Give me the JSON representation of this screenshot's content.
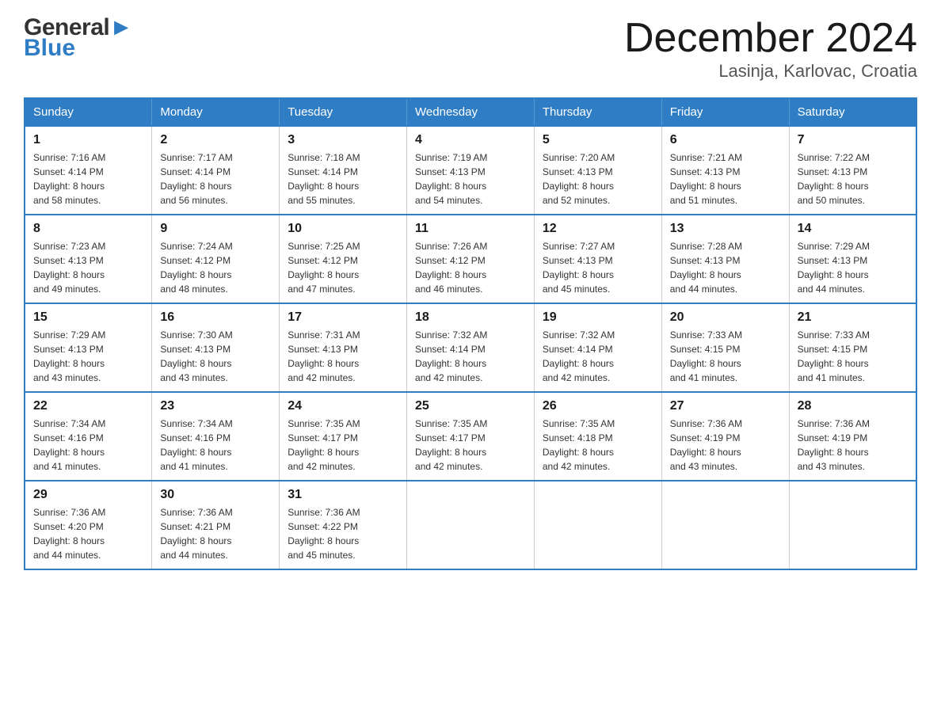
{
  "header": {
    "logo_line1": "General",
    "logo_line2": "Blue",
    "month_title": "December 2024",
    "location": "Lasinja, Karlovac, Croatia"
  },
  "columns": [
    "Sunday",
    "Monday",
    "Tuesday",
    "Wednesday",
    "Thursday",
    "Friday",
    "Saturday"
  ],
  "weeks": [
    [
      {
        "day": "1",
        "sunrise": "7:16 AM",
        "sunset": "4:14 PM",
        "daylight": "8 hours and 58 minutes."
      },
      {
        "day": "2",
        "sunrise": "7:17 AM",
        "sunset": "4:14 PM",
        "daylight": "8 hours and 56 minutes."
      },
      {
        "day": "3",
        "sunrise": "7:18 AM",
        "sunset": "4:14 PM",
        "daylight": "8 hours and 55 minutes."
      },
      {
        "day": "4",
        "sunrise": "7:19 AM",
        "sunset": "4:13 PM",
        "daylight": "8 hours and 54 minutes."
      },
      {
        "day": "5",
        "sunrise": "7:20 AM",
        "sunset": "4:13 PM",
        "daylight": "8 hours and 52 minutes."
      },
      {
        "day": "6",
        "sunrise": "7:21 AM",
        "sunset": "4:13 PM",
        "daylight": "8 hours and 51 minutes."
      },
      {
        "day": "7",
        "sunrise": "7:22 AM",
        "sunset": "4:13 PM",
        "daylight": "8 hours and 50 minutes."
      }
    ],
    [
      {
        "day": "8",
        "sunrise": "7:23 AM",
        "sunset": "4:13 PM",
        "daylight": "8 hours and 49 minutes."
      },
      {
        "day": "9",
        "sunrise": "7:24 AM",
        "sunset": "4:12 PM",
        "daylight": "8 hours and 48 minutes."
      },
      {
        "day": "10",
        "sunrise": "7:25 AM",
        "sunset": "4:12 PM",
        "daylight": "8 hours and 47 minutes."
      },
      {
        "day": "11",
        "sunrise": "7:26 AM",
        "sunset": "4:12 PM",
        "daylight": "8 hours and 46 minutes."
      },
      {
        "day": "12",
        "sunrise": "7:27 AM",
        "sunset": "4:13 PM",
        "daylight": "8 hours and 45 minutes."
      },
      {
        "day": "13",
        "sunrise": "7:28 AM",
        "sunset": "4:13 PM",
        "daylight": "8 hours and 44 minutes."
      },
      {
        "day": "14",
        "sunrise": "7:29 AM",
        "sunset": "4:13 PM",
        "daylight": "8 hours and 44 minutes."
      }
    ],
    [
      {
        "day": "15",
        "sunrise": "7:29 AM",
        "sunset": "4:13 PM",
        "daylight": "8 hours and 43 minutes."
      },
      {
        "day": "16",
        "sunrise": "7:30 AM",
        "sunset": "4:13 PM",
        "daylight": "8 hours and 43 minutes."
      },
      {
        "day": "17",
        "sunrise": "7:31 AM",
        "sunset": "4:13 PM",
        "daylight": "8 hours and 42 minutes."
      },
      {
        "day": "18",
        "sunrise": "7:32 AM",
        "sunset": "4:14 PM",
        "daylight": "8 hours and 42 minutes."
      },
      {
        "day": "19",
        "sunrise": "7:32 AM",
        "sunset": "4:14 PM",
        "daylight": "8 hours and 42 minutes."
      },
      {
        "day": "20",
        "sunrise": "7:33 AM",
        "sunset": "4:15 PM",
        "daylight": "8 hours and 41 minutes."
      },
      {
        "day": "21",
        "sunrise": "7:33 AM",
        "sunset": "4:15 PM",
        "daylight": "8 hours and 41 minutes."
      }
    ],
    [
      {
        "day": "22",
        "sunrise": "7:34 AM",
        "sunset": "4:16 PM",
        "daylight": "8 hours and 41 minutes."
      },
      {
        "day": "23",
        "sunrise": "7:34 AM",
        "sunset": "4:16 PM",
        "daylight": "8 hours and 41 minutes."
      },
      {
        "day": "24",
        "sunrise": "7:35 AM",
        "sunset": "4:17 PM",
        "daylight": "8 hours and 42 minutes."
      },
      {
        "day": "25",
        "sunrise": "7:35 AM",
        "sunset": "4:17 PM",
        "daylight": "8 hours and 42 minutes."
      },
      {
        "day": "26",
        "sunrise": "7:35 AM",
        "sunset": "4:18 PM",
        "daylight": "8 hours and 42 minutes."
      },
      {
        "day": "27",
        "sunrise": "7:36 AM",
        "sunset": "4:19 PM",
        "daylight": "8 hours and 43 minutes."
      },
      {
        "day": "28",
        "sunrise": "7:36 AM",
        "sunset": "4:19 PM",
        "daylight": "8 hours and 43 minutes."
      }
    ],
    [
      {
        "day": "29",
        "sunrise": "7:36 AM",
        "sunset": "4:20 PM",
        "daylight": "8 hours and 44 minutes."
      },
      {
        "day": "30",
        "sunrise": "7:36 AM",
        "sunset": "4:21 PM",
        "daylight": "8 hours and 44 minutes."
      },
      {
        "day": "31",
        "sunrise": "7:36 AM",
        "sunset": "4:22 PM",
        "daylight": "8 hours and 45 minutes."
      },
      null,
      null,
      null,
      null
    ]
  ],
  "labels": {
    "sunrise_prefix": "Sunrise: ",
    "sunset_prefix": "Sunset: ",
    "daylight_prefix": "Daylight: "
  }
}
